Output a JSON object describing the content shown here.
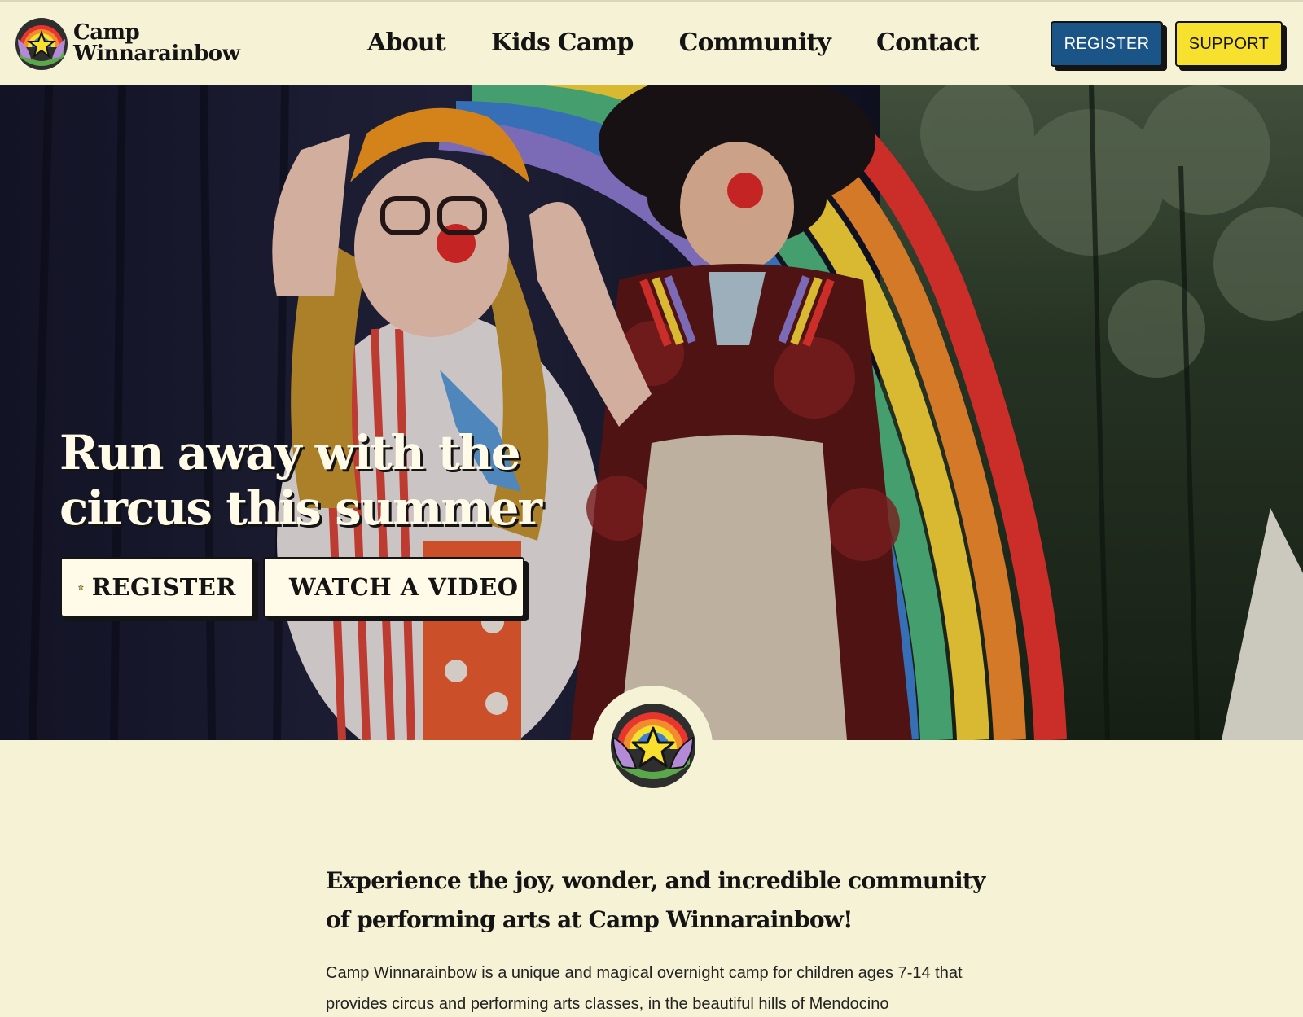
{
  "brand": {
    "name_line1": "Camp",
    "name_line2": "Winnarainbow",
    "colors": {
      "background": "#f5f2d6",
      "register_blue": "#1b5487",
      "support_yellow": "#f7e02e",
      "ink": "#141414"
    }
  },
  "nav": {
    "items": [
      {
        "label": "About"
      },
      {
        "label": "Kids Camp"
      },
      {
        "label": "Community"
      },
      {
        "label": "Contact"
      }
    ]
  },
  "header_buttons": {
    "register_label": "REGISTER",
    "support_label": "SUPPORT"
  },
  "hero": {
    "title": "Run away with the circus this summer",
    "register_label": "REGISTER",
    "register_icon": "star-icon",
    "video_label": "WATCH A VIDEO",
    "video_icon": "play-icon"
  },
  "intro": {
    "lead": "Experience the joy, wonder, and incredible community of performing arts at Camp Winnarainbow!",
    "body": "Camp Winnarainbow is a unique and magical overnight camp for children ages 7-14 that provides circus and performing arts classes, in the beautiful hills of Mendocino"
  }
}
